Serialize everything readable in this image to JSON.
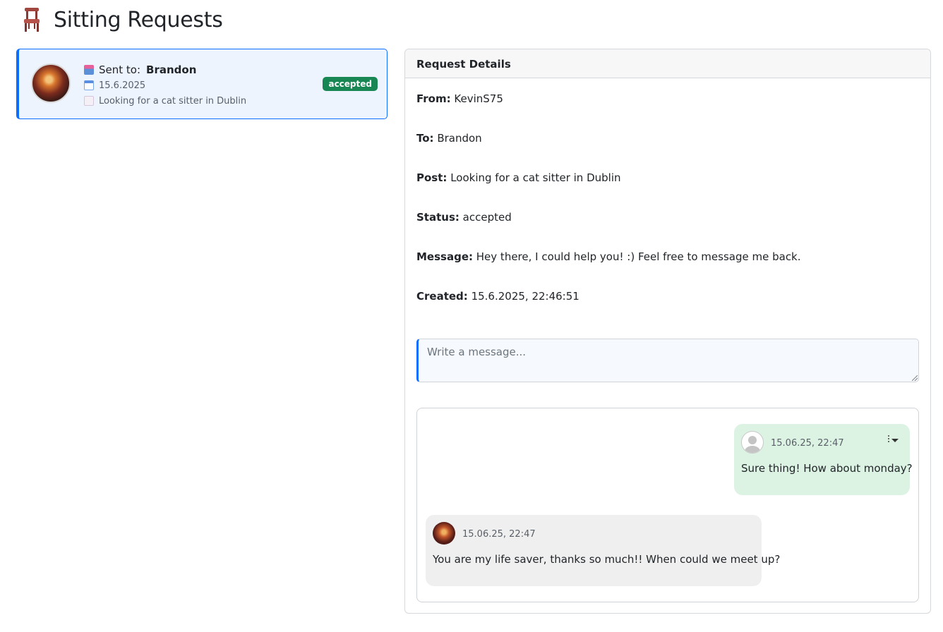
{
  "page": {
    "title": "Sitting Requests"
  },
  "request_list": [
    {
      "sent_to_label": "Sent to:",
      "recipient": "Brandon",
      "date": "15.6.2025",
      "post": "Looking for a cat sitter in Dublin",
      "status": "accepted",
      "status_color": "#198754"
    }
  ],
  "details": {
    "header": "Request Details",
    "from_label": "From:",
    "from": "KevinS75",
    "to_label": "To:",
    "to": "Brandon",
    "post_label": "Post:",
    "post": "Looking for a cat sitter in Dublin",
    "status_label": "Status:",
    "status": "accepted",
    "message_label": "Message:",
    "message": "Hey there, I could help you! :) Feel free to message me back.",
    "created_label": "Created:",
    "created": "15.6.2025, 22:46:51"
  },
  "composer": {
    "placeholder": "Write a message..."
  },
  "messages": [
    {
      "time": "15.06.25, 22:47",
      "text": "Sure thing! How about monday?",
      "mine": true
    },
    {
      "time": "15.06.25, 22:47",
      "text": "You are my life saver, thanks so much!! When could we meet up?",
      "mine": false
    }
  ],
  "colors": {
    "accent": "#0d6efd",
    "success": "#198754",
    "my_bubble": "#dcf3e4",
    "other_bubble": "#efefef"
  }
}
